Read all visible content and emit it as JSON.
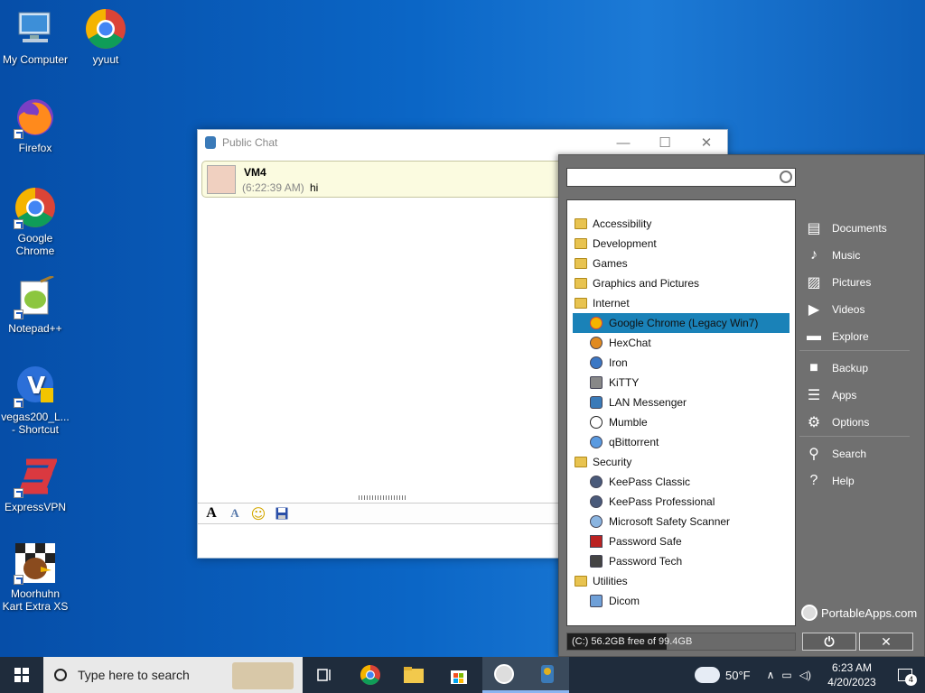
{
  "desktop_icons": [
    {
      "label": "My Computer",
      "x": 0
    },
    {
      "label": "yyuut"
    },
    {
      "label": "Firefox"
    },
    {
      "label": "Google Chrome"
    },
    {
      "label": "Notepad++"
    },
    {
      "label": "vegas200_L... - Shortcut"
    },
    {
      "label": "ExpressVPN"
    },
    {
      "label": "Moorhuhn Kart Extra XS"
    }
  ],
  "chat": {
    "title": "Public Chat",
    "message": {
      "user": "VM4",
      "time": "(6:22:39 AM)",
      "text": "hi"
    },
    "tools": [
      "A",
      "A",
      "☺",
      "💾"
    ]
  },
  "portableapps": {
    "search_placeholder": "",
    "items": [
      {
        "kind": "cat",
        "label": "Accessibility"
      },
      {
        "kind": "cat",
        "label": "Development"
      },
      {
        "kind": "cat",
        "label": "Games"
      },
      {
        "kind": "cat",
        "label": "Graphics and Pictures"
      },
      {
        "kind": "cat",
        "label": "Internet"
      },
      {
        "kind": "app",
        "label": "Google Chrome (Legacy Win7)",
        "selected": true
      },
      {
        "kind": "app",
        "label": "HexChat"
      },
      {
        "kind": "app",
        "label": "Iron"
      },
      {
        "kind": "app",
        "label": "KiTTY"
      },
      {
        "kind": "app",
        "label": "LAN Messenger"
      },
      {
        "kind": "app",
        "label": "Mumble"
      },
      {
        "kind": "app",
        "label": "qBittorrent"
      },
      {
        "kind": "cat",
        "label": "Security"
      },
      {
        "kind": "app",
        "label": "KeePass Classic"
      },
      {
        "kind": "app",
        "label": "KeePass Professional"
      },
      {
        "kind": "app",
        "label": "Microsoft Safety Scanner"
      },
      {
        "kind": "app",
        "label": "Password Safe"
      },
      {
        "kind": "app",
        "label": "Password Tech"
      },
      {
        "kind": "cat",
        "label": "Utilities"
      },
      {
        "kind": "app",
        "label": "Dicom"
      }
    ],
    "right_menu": {
      "group1": [
        {
          "label": "Documents",
          "icon": "documents-icon"
        },
        {
          "label": "Music",
          "icon": "music-icon"
        },
        {
          "label": "Pictures",
          "icon": "pictures-icon"
        },
        {
          "label": "Videos",
          "icon": "videos-icon"
        },
        {
          "label": "Explore",
          "icon": "folder-icon"
        }
      ],
      "group2": [
        {
          "label": "Backup",
          "icon": "backup-icon"
        },
        {
          "label": "Apps",
          "icon": "apps-icon"
        },
        {
          "label": "Options",
          "icon": "gear-icon"
        }
      ],
      "group3": [
        {
          "label": "Search",
          "icon": "search-icon"
        },
        {
          "label": "Help",
          "icon": "help-icon"
        }
      ]
    },
    "brand": "PortableApps.com",
    "drive_status": "(C:) 56.2GB free of 99.4GB",
    "drive_used_fraction": 0.435
  },
  "taskbar": {
    "search_placeholder": "Type here to search",
    "weather": "50°F",
    "time": "6:23 AM",
    "date": "4/20/2023",
    "notifications": "4"
  }
}
